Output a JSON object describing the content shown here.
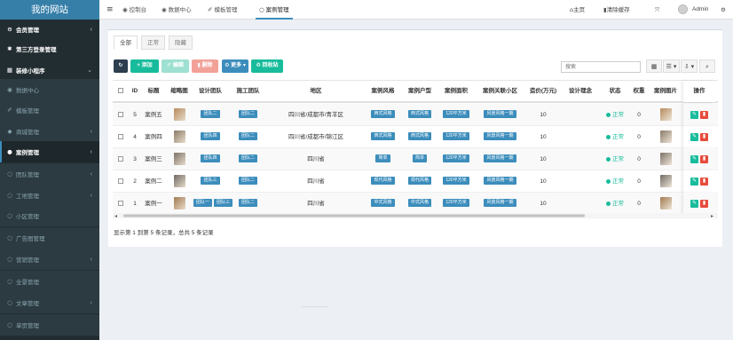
{
  "brand": "我的网站",
  "sidebar": {
    "items": [
      {
        "label": "会员管理",
        "icon": "user-circle-icon",
        "glyph": "⊖",
        "arrow": "‹",
        "type": "root"
      },
      {
        "label": "第三方登录管理",
        "icon": "share-icon",
        "glyph": "✱",
        "arrow": "",
        "type": "root"
      },
      {
        "label": "装修小程序",
        "icon": "building-icon",
        "glyph": "▦",
        "arrow": "⌄",
        "type": "root"
      },
      {
        "label": "数据中心",
        "icon": "dashboard-icon",
        "glyph": "◉",
        "arrow": "",
        "type": "sub"
      },
      {
        "label": "模板管理",
        "icon": "magic-icon",
        "glyph": "✐",
        "arrow": "",
        "type": "sub"
      },
      {
        "label": "商城管理",
        "icon": "shop-icon",
        "glyph": "◆",
        "arrow": "‹",
        "type": "sub"
      },
      {
        "label": "案例管理",
        "icon": "circle-icon",
        "glyph": "●",
        "arrow": "‹",
        "type": "active"
      },
      {
        "label": "团队管理",
        "icon": "circle-o-icon",
        "glyph": "○",
        "arrow": "‹",
        "type": "sub"
      },
      {
        "label": "工地管理",
        "icon": "circle-o-icon",
        "glyph": "○",
        "arrow": "‹",
        "type": "sub"
      },
      {
        "label": "小区管理",
        "icon": "circle-o-icon",
        "glyph": "○",
        "arrow": "",
        "type": "sub"
      },
      {
        "label": "广告图管理",
        "icon": "circle-o-icon",
        "glyph": "○",
        "arrow": "",
        "type": "sub"
      },
      {
        "label": "营销管理",
        "icon": "circle-o-icon",
        "glyph": "○",
        "arrow": "‹",
        "type": "sub"
      },
      {
        "label": "全景管理",
        "icon": "circle-o-icon",
        "glyph": "○",
        "arrow": "",
        "type": "sub"
      },
      {
        "label": "文章管理",
        "icon": "circle-o-icon",
        "glyph": "○",
        "arrow": "‹",
        "type": "sub"
      },
      {
        "label": "单页管理",
        "icon": "circle-o-icon",
        "glyph": "○",
        "arrow": "",
        "type": "sub"
      }
    ]
  },
  "topbar": {
    "menu_glyph": "≡",
    "tabs": [
      {
        "label": "控制台",
        "glyph": "◉",
        "icon": "dashboard-icon"
      },
      {
        "label": "数据中心",
        "glyph": "◉",
        "icon": "dashboard-icon"
      },
      {
        "label": "模板管理",
        "glyph": "✐",
        "icon": "magic-icon"
      },
      {
        "label": "案例管理",
        "glyph": "○",
        "icon": "circle-o-icon"
      }
    ],
    "home": "主页",
    "home_glyph": "⌂",
    "clear_cache": "清除缓存",
    "clear_glyph": "▮",
    "fullscreen_glyph": "⤧",
    "user": "Admin",
    "settings_glyph": "⚙"
  },
  "filter_tabs": [
    "全部",
    "正常",
    "隐藏"
  ],
  "toolbar": {
    "refresh": "↻",
    "add": "+ 添加",
    "edit": "✐ 编辑",
    "delete": "▮ 删除",
    "more": "⚙ 更多 ▾",
    "recycle": "♻ 回收站",
    "search_placeholder": "搜索",
    "view_glyph": "▦",
    "list_glyph": "☰ ▾",
    "export_glyph": "⇩ ▾",
    "search_glyph": "⌕"
  },
  "table": {
    "headers": [
      "ID",
      "标题",
      "缩略图",
      "设计团队",
      "施工团队",
      "地区",
      "案例风格",
      "案例户型",
      "案例面积",
      "案例关联小区",
      "造价(万元)",
      "设计理念",
      "状态",
      "权重",
      "案例图片",
      "操作"
    ],
    "rows": [
      {
        "id": "5",
        "title": "案例五",
        "design": [
          "团队二"
        ],
        "build": [
          "团队二"
        ],
        "region": "四川省/成都市/青羊区",
        "style": "西式风格",
        "house": "西式风格",
        "area": "120平方米",
        "community": "风景风格一期",
        "cost": "10",
        "status": "正常",
        "weight": "0",
        "thumb": "#b58a5c"
      },
      {
        "id": "4",
        "title": "案例四",
        "design": [
          "团队四"
        ],
        "build": [
          "团队二"
        ],
        "region": "四川省/成都市/锦江区",
        "style": "西式风格",
        "house": "西式风格",
        "area": "120平方米",
        "community": "风景风格一期",
        "cost": "10",
        "status": "正常",
        "weight": "0",
        "thumb": "#8a7a68"
      },
      {
        "id": "3",
        "title": "案例三",
        "design": [
          "团队四"
        ],
        "build": [
          "团队二"
        ],
        "region": "四川省",
        "style": "简单",
        "house": "简单",
        "area": "120平方米",
        "community": "风景风格一期",
        "cost": "10",
        "status": "正常",
        "weight": "0",
        "thumb": "#7d7268"
      },
      {
        "id": "2",
        "title": "案例二",
        "design": [
          "团队三"
        ],
        "build": [
          "团队二"
        ],
        "region": "四川省",
        "style": "现代风格",
        "house": "现代风格",
        "area": "120平方米",
        "community": "风景风格一期",
        "cost": "10",
        "status": "正常",
        "weight": "0",
        "thumb": "#6f6a64"
      },
      {
        "id": "1",
        "title": "案例一",
        "design": [
          "团队一",
          "团队三"
        ],
        "build": [
          "团队二"
        ],
        "region": "四川省",
        "style": "中式风格",
        "house": "中式风格",
        "area": "120平方米",
        "community": "风景风格一期",
        "cost": "10",
        "status": "正常",
        "weight": "0",
        "thumb": "#a07a4e"
      }
    ],
    "edit_glyph": "✎",
    "delete_glyph": "▮"
  },
  "pager": "显示第 1 到第 5 条记录，总共 5 条记录",
  "colors": {
    "sidebar": "#222d32",
    "brand": "#367fa9",
    "primary": "#3c8dbc",
    "success": "#18bc9c",
    "danger": "#e74c3c",
    "warning": "#f39c12",
    "dark": "#2c3e50"
  }
}
